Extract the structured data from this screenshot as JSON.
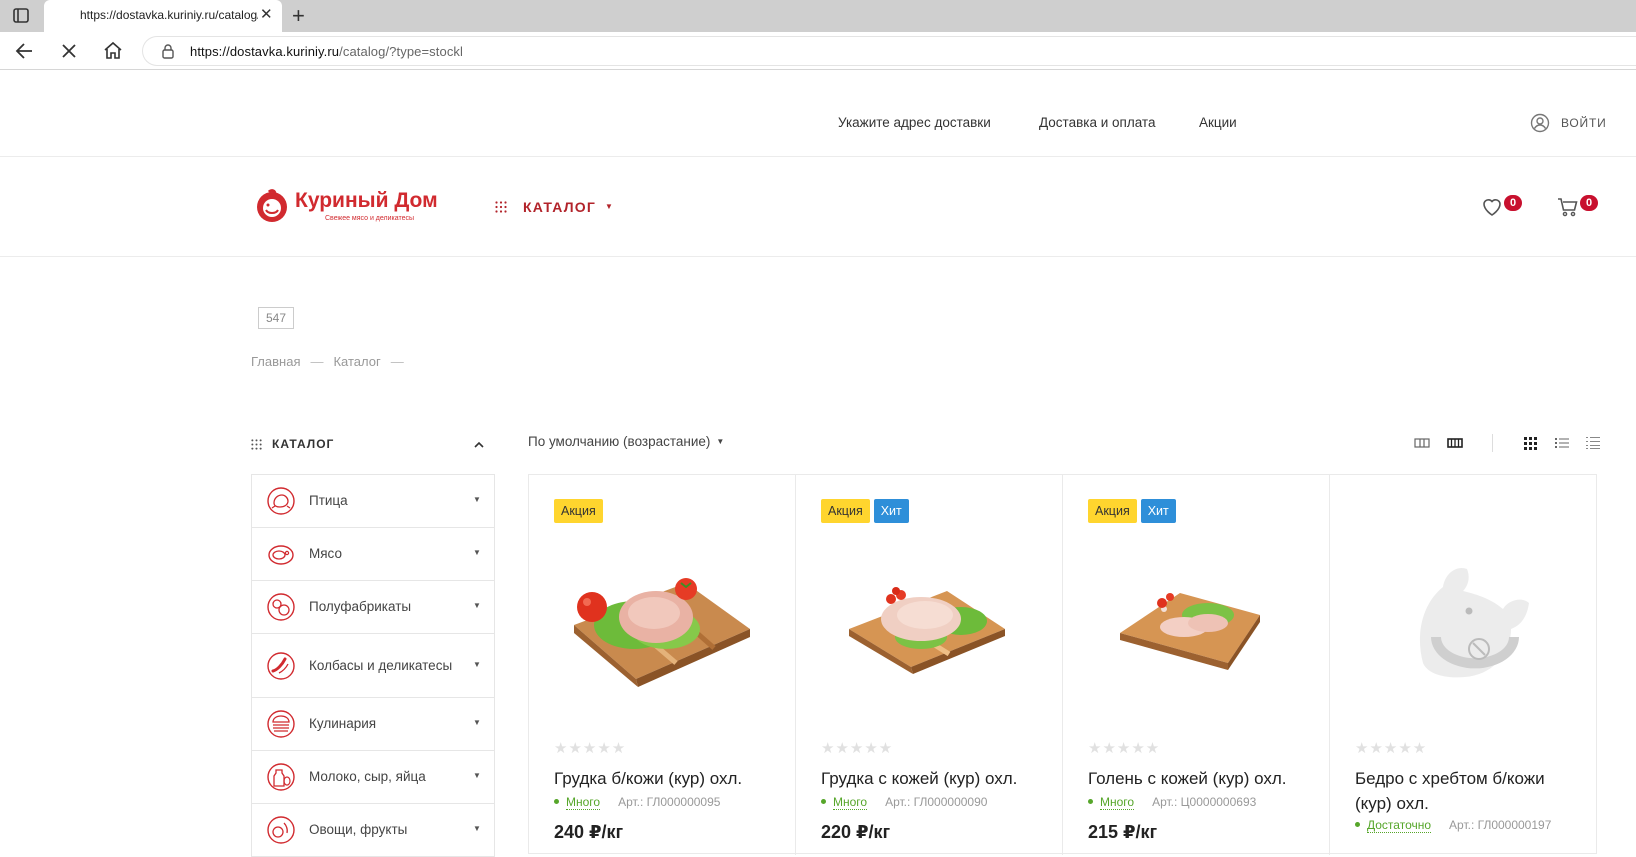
{
  "browser": {
    "tab_title": "https://dostavka.kuriniy.ru/catalog/?type=stockl",
    "tab_close": "✕",
    "new_tab": "+",
    "url_host": "https://dostavka.kuriniy.ru",
    "url_path": "/catalog/?type=stockl"
  },
  "topbar": {
    "delivery_address": "Укажите адрес доставки",
    "delivery_payment": "Доставка и оплата",
    "promotions": "Акции",
    "login": "ВОЙТИ"
  },
  "header": {
    "logo_name": "Куриный Дом",
    "logo_tagline": "Свежее мясо и деликатесы",
    "catalog_label": "КАТАЛОГ",
    "wishlist_count": "0",
    "cart_count": "0"
  },
  "page": {
    "count": "547",
    "breadcrumb": [
      "Главная",
      "Каталог"
    ],
    "breadcrumb_sep": "—"
  },
  "sidebar": {
    "title": "КАТАЛОГ",
    "items": [
      {
        "label": "Птица",
        "icon": "chicken-icon"
      },
      {
        "label": "Мясо",
        "icon": "steak-icon"
      },
      {
        "label": "Полуфабрикаты",
        "icon": "semi-finished-icon"
      },
      {
        "label": "Колбасы и деликатесы",
        "icon": "sausage-icon"
      },
      {
        "label": "Кулинария",
        "icon": "burger-icon"
      },
      {
        "label": "Молоко, сыр, яйца",
        "icon": "dairy-icon"
      },
      {
        "label": "Овощи, фрукты",
        "icon": "vegetables-icon"
      }
    ]
  },
  "sort": {
    "label": "По умолчанию (возрастание)"
  },
  "products": [
    {
      "tags": [
        "Акция"
      ],
      "title": "Грудка б/кожи (кур) охл.",
      "stock": "Много",
      "article": "Арт.: ГЛ000000095",
      "price": "240 ₽/кг",
      "rating": 0
    },
    {
      "tags": [
        "Акция",
        "Хит"
      ],
      "title": "Грудка с кожей (кур) охл.",
      "stock": "Много",
      "article": "Арт.: ГЛ000000090",
      "price": "220 ₽/кг",
      "rating": 0
    },
    {
      "tags": [
        "Акция",
        "Хит"
      ],
      "title": "Голень с кожей (кур) охл.",
      "stock": "Много",
      "article": "Арт.: Ц0000000693",
      "price": "215 ₽/кг",
      "rating": 0
    },
    {
      "tags": [],
      "title": "Бедро с хребтом б/кожи (кур) охл.",
      "stock": "Достаточно",
      "article": "Арт.: ГЛ000000197",
      "price": "",
      "rating": 0
    }
  ],
  "colors": {
    "brand_red": "#d12a2f",
    "sale_yellow": "#ffd52e",
    "hit_blue": "#2e8fd9",
    "stock_green": "#56a62a"
  }
}
